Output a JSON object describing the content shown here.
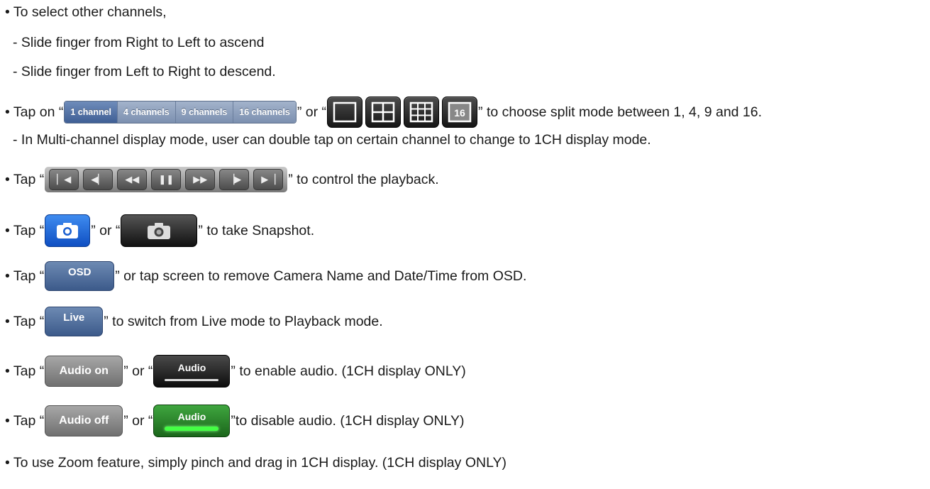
{
  "lines": {
    "l1": "• To select other channels,",
    "l2": "-  Slide finger from Right to Left to ascend",
    "l3": "-  Slide finger from Left to Right to descend.",
    "l4_pre": "• Tap on “",
    "l4_mid": "” or “",
    "l4_post": "” to choose split mode between 1, 4, 9 and 16.",
    "l5": "-  In Multi-channel display mode, user can double tap on certain channel to change to 1CH display mode.",
    "l6_pre": "• Tap “",
    "l6_post": "” to control the playback.",
    "l7_pre": "• Tap “",
    "l7_mid": "” or “",
    "l7_post": "” to take Snapshot.",
    "l8_pre": "• Tap “",
    "l8_post": "” or tap screen to remove Camera Name and Date/Time from OSD.",
    "l9_pre": "• Tap “",
    "l9_post": "” to switch from Live mode to Playback mode.",
    "l10_pre": "• Tap “",
    "l10_mid": "” or “",
    "l10_post": "” to enable audio. (1CH display ONLY)",
    "l11_pre": "• Tap “",
    "l11_mid": "” or “",
    "l11_post": "”to disable audio. (1CH display ONLY)",
    "l12": "• To use Zoom feature, simply pinch and drag in 1CH display. (1CH display ONLY)"
  },
  "segmented": [
    "1 channel",
    "4 channels",
    "9 channels",
    "16 channels"
  ],
  "split_icons": [
    "split-1-icon",
    "split-4-icon",
    "split-9-icon",
    "split-16-icon"
  ],
  "split_16_label": "16",
  "playback_icons": [
    "skip-start-icon",
    "step-back-icon",
    "rewind-icon",
    "pause-icon",
    "fast-forward-icon",
    "step-forward-icon",
    "skip-end-icon"
  ],
  "buttons": {
    "osd": "OSD",
    "live": "Live",
    "audio_on": "Audio on",
    "audio_off": "Audio off",
    "audio": "Audio"
  },
  "colors": {
    "segment_active": "#3f5f95",
    "segment": "#7c90b0",
    "snapshot_blue": "#1a5fd0",
    "audio_green": "#44ff44"
  }
}
